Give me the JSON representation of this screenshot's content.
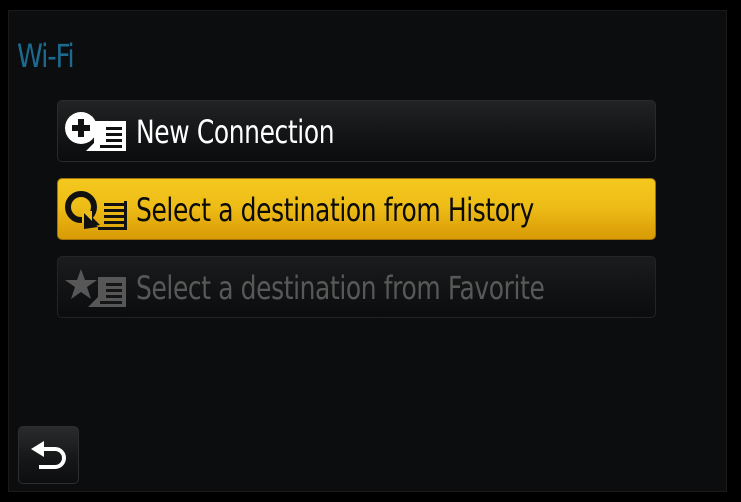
{
  "screen": {
    "title": "Wi-Fi"
  },
  "menu": {
    "items": [
      {
        "label": "New Connection",
        "icon": "plus-circle-list-icon",
        "state": "normal"
      },
      {
        "label": "Select a destination from History",
        "icon": "history-refresh-list-icon",
        "state": "selected"
      },
      {
        "label": "Select a destination from Favorite",
        "icon": "star-list-icon",
        "state": "disabled"
      }
    ]
  },
  "back_button": {
    "icon": "return-arrow-icon"
  },
  "colors": {
    "title": "#1d6a8f",
    "selected_highlight": "#eebd17",
    "background": "#0c0d0e",
    "disabled_text": "#585858"
  }
}
